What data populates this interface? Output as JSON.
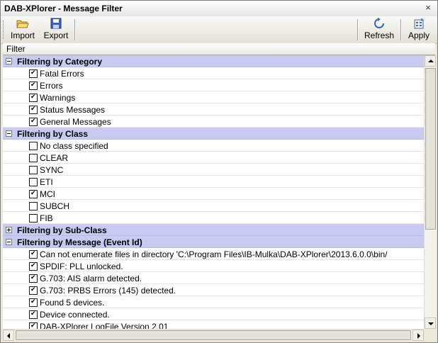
{
  "window": {
    "title": "DAB-XPlorer - Message Filter",
    "close_glyph": "×"
  },
  "toolbar": {
    "import_label": "Import",
    "export_label": "Export",
    "refresh_label": "Refresh",
    "apply_label": "Apply",
    "icons": {
      "import": "folder-open-icon",
      "export": "floppy-save-icon",
      "refresh": "refresh-icon",
      "apply": "apply-icon"
    }
  },
  "grid": {
    "column_header": "Filter"
  },
  "categories": [
    {
      "title": "Filtering by Category",
      "expanded": true,
      "items": [
        {
          "label": "Fatal Errors",
          "checked": true
        },
        {
          "label": "Errors",
          "checked": true
        },
        {
          "label": "Warnings",
          "checked": true
        },
        {
          "label": "Status Messages",
          "checked": true
        },
        {
          "label": "General Messages",
          "checked": true
        }
      ]
    },
    {
      "title": "Filtering by Class",
      "expanded": true,
      "items": [
        {
          "label": "No class specified",
          "checked": false
        },
        {
          "label": "CLEAR",
          "checked": false
        },
        {
          "label": "SYNC",
          "checked": false
        },
        {
          "label": "ETI",
          "checked": false
        },
        {
          "label": "MCI",
          "checked": true
        },
        {
          "label": "SUBCH",
          "checked": false
        },
        {
          "label": "FIB",
          "checked": false
        }
      ]
    },
    {
      "title": "Filtering by Sub-Class",
      "expanded": false,
      "items": []
    },
    {
      "title": "Filtering by Message (Event Id)",
      "expanded": true,
      "items": [
        {
          "label": "Can not enumerate files in directory 'C:\\Program Files\\IB-Mulka\\DAB-XPlorer\\2013.6.0.0\\bin/",
          "checked": true
        },
        {
          "label": "SPDIF: PLL unlocked.",
          "checked": true
        },
        {
          "label": "G.703: AIS alarm detected.",
          "checked": true
        },
        {
          "label": "G.703: PRBS Errors (145) detected.",
          "checked": true
        },
        {
          "label": "Found 5 devices.",
          "checked": true
        },
        {
          "label": "Device connected.",
          "checked": true
        },
        {
          "label": "DAB-XPlorer LogFile Version 2.01",
          "checked": true
        }
      ]
    }
  ],
  "colors": {
    "category_bg": "#c8cbf0",
    "row_bg": "#ffffff",
    "toolbar_bg": "#ece9d8"
  }
}
